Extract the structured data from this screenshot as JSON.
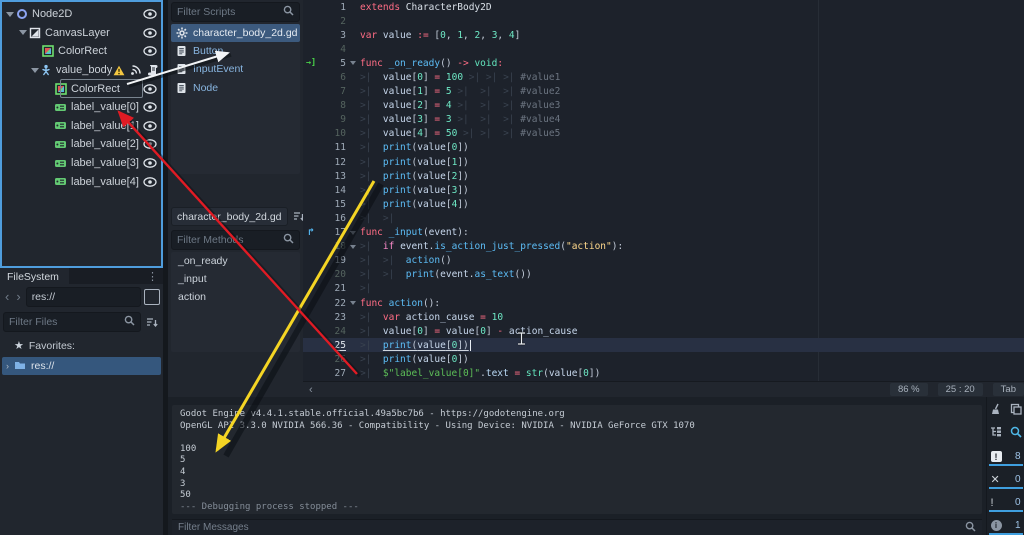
{
  "scene_dock": {
    "nodes": [
      {
        "label": "Node2D",
        "icon": "node2d",
        "level": 0,
        "arrow": "down",
        "eye": true
      },
      {
        "label": "CanvasLayer",
        "icon": "canvaslayer",
        "level": 1,
        "arrow": "down",
        "eye": true
      },
      {
        "label": "ColorRect",
        "icon": "colorrect",
        "level": 2,
        "arrow": null,
        "eye": true
      },
      {
        "label": "value_body",
        "icon": "body",
        "level": 2,
        "arrow": "down",
        "eye": true,
        "badges": [
          "warning",
          "signal",
          "script"
        ]
      },
      {
        "label": "ColorRect",
        "icon": "colorrect",
        "level": 3,
        "arrow": null,
        "eye": true,
        "selected": true
      },
      {
        "label": "label_value[0]",
        "icon": "label",
        "level": 3,
        "arrow": null,
        "eye": true
      },
      {
        "label": "label_value[1]",
        "icon": "label",
        "level": 3,
        "arrow": null,
        "eye": true
      },
      {
        "label": "label_value[2]",
        "icon": "label",
        "level": 3,
        "arrow": null,
        "eye": true
      },
      {
        "label": "label_value[3]",
        "icon": "label",
        "level": 3,
        "arrow": null,
        "eye": true
      },
      {
        "label": "label_value[4]",
        "icon": "label",
        "level": 3,
        "arrow": null,
        "eye": true
      }
    ]
  },
  "filesystem": {
    "tab": "FileSystem",
    "path_value": "res://",
    "filter_placeholder": "Filter Files",
    "favorites_label": "Favorites:",
    "root_item": "res://"
  },
  "script_panel": {
    "filter_scripts_placeholder": "Filter Scripts",
    "scripts": [
      {
        "label": "character_body_2d.gd",
        "icon": "gear",
        "selected": true
      },
      {
        "label": "Button",
        "icon": "doc"
      },
      {
        "label": "InputEvent",
        "icon": "doc"
      },
      {
        "label": "Node",
        "icon": "doc"
      }
    ],
    "file_selector": "character_body_2d.gd",
    "filter_methods_placeholder": "Filter Methods",
    "methods": [
      "_on_ready",
      "_input",
      "action"
    ]
  },
  "editor": {
    "status": {
      "zoom": "86 %",
      "cursor": "25 : 20",
      "indent": "Tab"
    },
    "lines": [
      {
        "n": 1,
        "segs": [
          [
            "k",
            "extends"
          ],
          [
            "w",
            " "
          ],
          [
            "c",
            "CharacterBody2D"
          ]
        ]
      },
      {
        "n": 2,
        "dim": true,
        "segs": []
      },
      {
        "n": 3,
        "segs": [
          [
            "k",
            "var"
          ],
          [
            "i",
            " value "
          ],
          [
            "o",
            ":= "
          ],
          [
            "p",
            "["
          ],
          [
            "n",
            "0"
          ],
          [
            "p",
            ", "
          ],
          [
            "n",
            "1"
          ],
          [
            "p",
            ", "
          ],
          [
            "n",
            "2"
          ],
          [
            "p",
            ", "
          ],
          [
            "n",
            "3"
          ],
          [
            "p",
            ", "
          ],
          [
            "n",
            "4"
          ],
          [
            "p",
            "]"
          ]
        ]
      },
      {
        "n": 4,
        "dim": true,
        "segs": []
      },
      {
        "n": 5,
        "fold": true,
        "gicon": "entry",
        "segs": [
          [
            "k",
            "func "
          ],
          [
            "f",
            "_on_ready"
          ],
          [
            "p",
            "()"
          ],
          [
            "o",
            " -> "
          ],
          [
            "y",
            "void"
          ],
          [
            "o",
            ":"
          ]
        ]
      },
      {
        "n": 6,
        "dim": true,
        "segs": [
          [
            "t",
            ">|  "
          ],
          [
            "i",
            "value"
          ],
          [
            "p",
            "["
          ],
          [
            "n",
            "0"
          ],
          [
            "p",
            "]"
          ],
          [
            "o",
            " = "
          ],
          [
            "n",
            "100"
          ],
          [
            "t",
            " >| >| >| "
          ],
          [
            "m",
            "#value1"
          ]
        ]
      },
      {
        "n": 7,
        "dim": true,
        "segs": [
          [
            "t",
            ">|  "
          ],
          [
            "i",
            "value"
          ],
          [
            "p",
            "["
          ],
          [
            "n",
            "1"
          ],
          [
            "p",
            "]"
          ],
          [
            "o",
            " = "
          ],
          [
            "n",
            "5"
          ],
          [
            "t",
            " >|  >|  >| "
          ],
          [
            "m",
            "#value2"
          ]
        ]
      },
      {
        "n": 8,
        "dim": true,
        "segs": [
          [
            "t",
            ">|  "
          ],
          [
            "i",
            "value"
          ],
          [
            "p",
            "["
          ],
          [
            "n",
            "2"
          ],
          [
            "p",
            "]"
          ],
          [
            "o",
            " = "
          ],
          [
            "n",
            "4"
          ],
          [
            "t",
            " >|  >|  >| "
          ],
          [
            "m",
            "#value3"
          ]
        ]
      },
      {
        "n": 9,
        "dim": true,
        "segs": [
          [
            "t",
            ">|  "
          ],
          [
            "i",
            "value"
          ],
          [
            "p",
            "["
          ],
          [
            "n",
            "3"
          ],
          [
            "p",
            "]"
          ],
          [
            "o",
            " = "
          ],
          [
            "n",
            "3"
          ],
          [
            "t",
            " >|  >|  >| "
          ],
          [
            "m",
            "#value4"
          ]
        ]
      },
      {
        "n": 10,
        "dim": true,
        "segs": [
          [
            "t",
            ">|  "
          ],
          [
            "i",
            "value"
          ],
          [
            "p",
            "["
          ],
          [
            "n",
            "4"
          ],
          [
            "p",
            "]"
          ],
          [
            "o",
            " = "
          ],
          [
            "n",
            "50"
          ],
          [
            "t",
            " >| >|  >| "
          ],
          [
            "m",
            "#value5"
          ]
        ]
      },
      {
        "n": 11,
        "segs": [
          [
            "t",
            ">|  "
          ],
          [
            "f",
            "print"
          ],
          [
            "p",
            "("
          ],
          [
            "i",
            "value"
          ],
          [
            "p",
            "["
          ],
          [
            "n",
            "0"
          ],
          [
            "p",
            "])"
          ]
        ]
      },
      {
        "n": 12,
        "segs": [
          [
            "t",
            ">|  "
          ],
          [
            "f",
            "print"
          ],
          [
            "p",
            "("
          ],
          [
            "i",
            "value"
          ],
          [
            "p",
            "["
          ],
          [
            "n",
            "1"
          ],
          [
            "p",
            "])"
          ]
        ]
      },
      {
        "n": 13,
        "segs": [
          [
            "t",
            ">|  "
          ],
          [
            "f",
            "print"
          ],
          [
            "p",
            "("
          ],
          [
            "i",
            "value"
          ],
          [
            "p",
            "["
          ],
          [
            "n",
            "2"
          ],
          [
            "p",
            "])"
          ]
        ]
      },
      {
        "n": 14,
        "segs": [
          [
            "t",
            ">|  "
          ],
          [
            "f",
            "print"
          ],
          [
            "p",
            "("
          ],
          [
            "i",
            "value"
          ],
          [
            "p",
            "["
          ],
          [
            "n",
            "3"
          ],
          [
            "p",
            "])"
          ]
        ]
      },
      {
        "n": 15,
        "segs": [
          [
            "t",
            ">|  "
          ],
          [
            "f",
            "print"
          ],
          [
            "p",
            "("
          ],
          [
            "i",
            "value"
          ],
          [
            "p",
            "["
          ],
          [
            "n",
            "4"
          ],
          [
            "p",
            "])"
          ]
        ]
      },
      {
        "n": 16,
        "segs": [
          [
            "t",
            ">|  "
          ],
          [
            "t",
            ">|"
          ]
        ]
      },
      {
        "n": 17,
        "fold": true,
        "gicon": "override",
        "segs": [
          [
            "k",
            "func "
          ],
          [
            "f",
            "_input"
          ],
          [
            "p",
            "("
          ],
          [
            "i",
            "event"
          ],
          [
            "p",
            "):"
          ]
        ]
      },
      {
        "n": 18,
        "dim": true,
        "fold": true,
        "segs": [
          [
            "t",
            ">|  "
          ],
          [
            "cf",
            "if "
          ],
          [
            "i",
            "event"
          ],
          [
            "p",
            "."
          ],
          [
            "f",
            "is_action_just_pressed"
          ],
          [
            "p",
            "("
          ],
          [
            "s",
            "\"action\""
          ],
          [
            "p",
            "):"
          ]
        ]
      },
      {
        "n": 19,
        "segs": [
          [
            "t",
            ">|  "
          ],
          [
            "t",
            ">|  "
          ],
          [
            "f",
            "action"
          ],
          [
            "p",
            "()"
          ]
        ]
      },
      {
        "n": 20,
        "dim": true,
        "segs": [
          [
            "t",
            ">|  "
          ],
          [
            "t",
            ">|  "
          ],
          [
            "f",
            "print"
          ],
          [
            "p",
            "("
          ],
          [
            "i",
            "event"
          ],
          [
            "p",
            "."
          ],
          [
            "f",
            "as_text"
          ],
          [
            "p",
            "())"
          ]
        ]
      },
      {
        "n": 21,
        "segs": [
          [
            "t",
            ">|"
          ]
        ]
      },
      {
        "n": 22,
        "fold": true,
        "segs": [
          [
            "k",
            "func "
          ],
          [
            "f",
            "action"
          ],
          [
            "p",
            "():"
          ]
        ]
      },
      {
        "n": 23,
        "segs": [
          [
            "t",
            ">|  "
          ],
          [
            "k",
            "var"
          ],
          [
            "i",
            " action_cause "
          ],
          [
            "o",
            "= "
          ],
          [
            "n",
            "10"
          ]
        ]
      },
      {
        "n": 24,
        "dim": true,
        "segs": [
          [
            "t",
            ">|  "
          ],
          [
            "i",
            "value"
          ],
          [
            "p",
            "["
          ],
          [
            "n",
            "0"
          ],
          [
            "p",
            "]"
          ],
          [
            "o",
            " = "
          ],
          [
            "i",
            "value"
          ],
          [
            "p",
            "["
          ],
          [
            "n",
            "0"
          ],
          [
            "p",
            "]"
          ],
          [
            "o",
            " - "
          ],
          [
            "i",
            "action_cause"
          ]
        ]
      },
      {
        "n": 25,
        "current": true,
        "underline": true,
        "caret": true,
        "segs": [
          [
            "t",
            ">|  "
          ],
          [
            "f",
            "print"
          ],
          [
            "p",
            "("
          ],
          [
            "i",
            "value"
          ],
          [
            "p",
            "["
          ],
          [
            "n",
            "0"
          ],
          [
            "p",
            "])"
          ]
        ]
      },
      {
        "n": 26,
        "dim": true,
        "segs": [
          [
            "t",
            ">|  "
          ],
          [
            "f",
            "print"
          ],
          [
            "p",
            "("
          ],
          [
            "i",
            "value"
          ],
          [
            "p",
            "["
          ],
          [
            "n",
            "0"
          ],
          [
            "p",
            "])"
          ]
        ]
      },
      {
        "n": 27,
        "segs": [
          [
            "t",
            ">|  "
          ],
          [
            "g",
            "$\"label_value[0]\""
          ],
          [
            "p",
            "."
          ],
          [
            "mb",
            "text"
          ],
          [
            "o",
            " = "
          ],
          [
            "y",
            "str"
          ],
          [
            "p",
            "("
          ],
          [
            "i",
            "value"
          ],
          [
            "p",
            "["
          ],
          [
            "n",
            "0"
          ],
          [
            "p",
            "])"
          ]
        ]
      }
    ]
  },
  "output": {
    "console_lines": [
      {
        "text": "Godot Engine v4.4.1.stable.official.49a5bc7b6 - https://godotengine.org"
      },
      {
        "text": "OpenGL API 3.3.0 NVIDIA 566.36 - Compatibility - Using Device: NVIDIA - NVIDIA GeForce GTX 1070"
      },
      {
        "text": ""
      },
      {
        "text": "100"
      },
      {
        "text": "5"
      },
      {
        "text": "4"
      },
      {
        "text": "3"
      },
      {
        "text": "50"
      },
      {
        "text": "--- Debugging process stopped ---",
        "dim": true
      }
    ],
    "filter_placeholder": "Filter Messages",
    "badges": [
      {
        "type": "alert",
        "count": "8"
      },
      {
        "type": "error",
        "count": "0"
      },
      {
        "type": "warning",
        "count": "0"
      },
      {
        "type": "info",
        "count": "1"
      }
    ]
  },
  "colors": {
    "accent_blue": "#4f9ddd",
    "selection_blue": "#3c5a7e",
    "keyword_red": "#ff6d85",
    "number_mint": "#6ee8c5",
    "string_yellow": "#ffd98c",
    "node_path_green": "#5dbf58",
    "annotation_white": "#f2f4f6",
    "annotation_red": "#e01b24",
    "annotation_yellow": "#f5d524"
  }
}
